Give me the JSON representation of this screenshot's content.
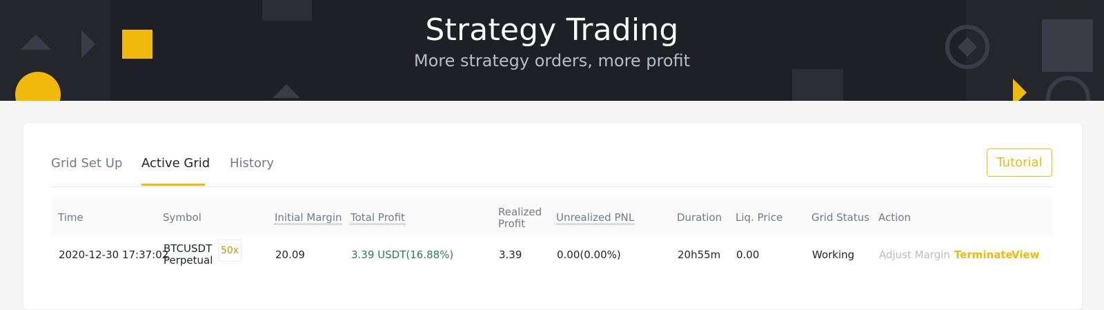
{
  "hero": {
    "title": "Strategy Trading",
    "subtitle": "More strategy orders, more profit"
  },
  "tabs": [
    {
      "label": "Grid Set Up"
    },
    {
      "label": "Active Grid"
    },
    {
      "label": "History"
    }
  ],
  "active_tab": "Active Grid",
  "tutorial_label": "Tutorial",
  "table": {
    "headers": {
      "time": "Time",
      "symbol": "Symbol",
      "initial_margin": "Initial Margin",
      "total_profit": "Total Profit",
      "realized_profit_1": "Realized",
      "realized_profit_2": "Profit",
      "unrealized_pnl": "Unrealized PNL",
      "duration": "Duration",
      "liq_price": "Liq. Price",
      "grid_status": "Grid Status",
      "action": "Action"
    },
    "rows": [
      {
        "time": "2020-12-30 17:37:02",
        "symbol_1": "BTCUSDT",
        "symbol_2": "Perpetual",
        "leverage": "50x",
        "initial_margin": "20.09",
        "total_profit": "3.39 USDT(16.88%)",
        "realized_profit": "3.39",
        "unrealized_pnl": "0.00(0.00%)",
        "duration": "20h55m",
        "liq_price": "0.00",
        "grid_status": "Working",
        "actions": {
          "adjust_margin": "Adjust Margin",
          "terminate": "Terminate",
          "view": "View"
        }
      }
    ]
  },
  "colors": {
    "accent": "#f0b90b",
    "profit_green": "#2e7d4f",
    "hero_bg": "#1e2026",
    "muted": "#b7bdc6"
  }
}
